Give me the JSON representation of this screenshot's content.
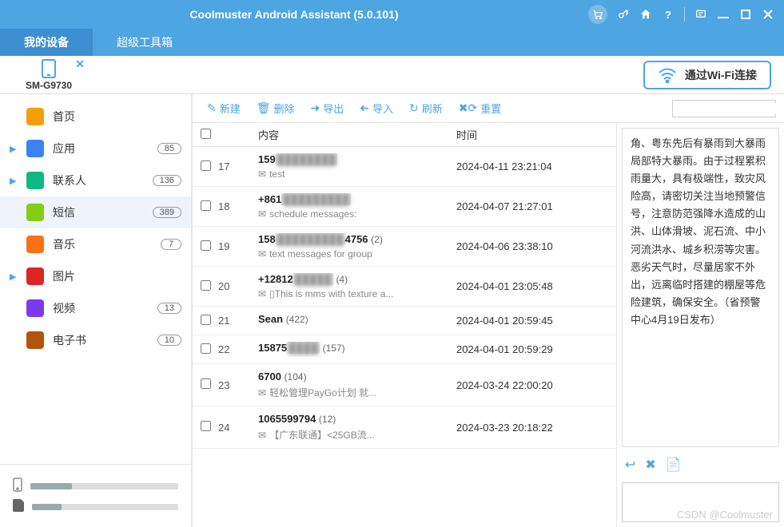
{
  "app": {
    "title": "Coolmuster Android Assistant (5.0.101)"
  },
  "tabs": {
    "device": "我的设备",
    "toolbox": "超级工具箱"
  },
  "device": {
    "name": "SM-G9730",
    "wifi_btn": "通过Wi-Fi连接"
  },
  "sidebar": {
    "items": [
      {
        "label": "首页",
        "badge": "",
        "icon": "home",
        "expandable": false
      },
      {
        "label": "应用",
        "badge": "85",
        "icon": "apps",
        "expandable": true
      },
      {
        "label": "联系人",
        "badge": "136",
        "icon": "contacts",
        "expandable": true
      },
      {
        "label": "短信",
        "badge": "389",
        "icon": "sms",
        "expandable": false,
        "active": true
      },
      {
        "label": "音乐",
        "badge": "7",
        "icon": "music",
        "expandable": false
      },
      {
        "label": "图片",
        "badge": "",
        "icon": "photos",
        "expandable": true
      },
      {
        "label": "视频",
        "badge": "13",
        "icon": "video",
        "expandable": false
      },
      {
        "label": "电子书",
        "badge": "10",
        "icon": "ebook",
        "expandable": false
      }
    ]
  },
  "storage": {
    "internal_pct": 28,
    "sd_pct": 20
  },
  "toolbar": {
    "new": "新建",
    "delete": "删除",
    "export": "导出",
    "import": "导入",
    "refresh": "刷新",
    "reset": "重置"
  },
  "columns": {
    "content": "内容",
    "time": "时间"
  },
  "messages": [
    {
      "num": "17",
      "sender": "159",
      "sender_blur": "████████",
      "count": "",
      "preview": "test",
      "time": "2024-04-11 23:21:04"
    },
    {
      "num": "18",
      "sender": "+861",
      "sender_blur": "█████████",
      "count": "",
      "preview": "schedule messages:",
      "time": "2024-04-07 21:27:01"
    },
    {
      "num": "19",
      "sender": "158",
      "sender_blur": "█████████",
      "sender_tail": "4756",
      "count": "(2)",
      "preview": "text messages for group",
      "time": "2024-04-06 23:38:10"
    },
    {
      "num": "20",
      "sender": "+12812",
      "sender_blur": "█████",
      "count": "(4)",
      "preview": "▯This is mms with texture a...",
      "time": "2024-04-01 23:05:48"
    },
    {
      "num": "21",
      "sender": "Sean",
      "count": "(422)",
      "preview": "",
      "time": "2024-04-01 20:59:45"
    },
    {
      "num": "22",
      "sender": "15875",
      "sender_blur": "████",
      "count": "(157)",
      "preview": "",
      "time": "2024-04-01 20:59:29"
    },
    {
      "num": "23",
      "sender": "6700",
      "count": "(104)",
      "preview": "轻松管理PayGo计划 就...",
      "time": "2024-03-24 22:00:20"
    },
    {
      "num": "24",
      "sender": "1065599794",
      "count": "(12)",
      "preview": "【广东联通】<25GB流...",
      "time": "2024-03-23 20:18:22"
    }
  ],
  "preview_text": "角、粤东先后有暴雨到大暴雨局部特大暴雨。由于过程累积雨量大，具有极端性，致灾风险高，请密切关注当地预警信号，注意防范强降水造成的山洪、山体滑坡、泥石流、中小河流洪水、城乡积涝等灾害。恶劣天气时，尽量居家不外出，远离临时搭建的棚屋等危险建筑，确保安全。（省预警中心4月19日发布）",
  "watermark": "CSDN @Coolmuster"
}
